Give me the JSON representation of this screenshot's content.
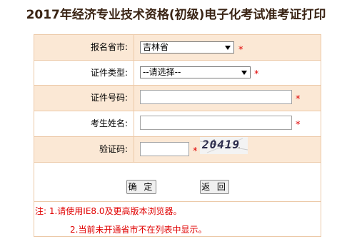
{
  "title": "2017年经济专业技术资格(初级)电子化考试准考证打印",
  "form": {
    "province_label": "报名省市:",
    "province_value": "吉林省",
    "id_type_label": "证件类型:",
    "id_type_value": "--请选择--",
    "id_number_label": "证件号码:",
    "id_number_value": "",
    "name_label": "考生姓名:",
    "name_value": "",
    "captcha_label": "验证码:",
    "captcha_value": "",
    "captcha_image_text": "20419",
    "required_mark": "*"
  },
  "buttons": {
    "confirm": "确 定",
    "back": "返 回"
  },
  "notes": {
    "line1": "注: 1.请使用IE8.0及更高版本浏览器。",
    "line2": "2.当前未开通省市不在列表中显示。"
  },
  "colors": {
    "title": "#3a2414",
    "row_shade": "#fbe8d5",
    "border": "#ecc9a8",
    "required": "#e00000"
  }
}
